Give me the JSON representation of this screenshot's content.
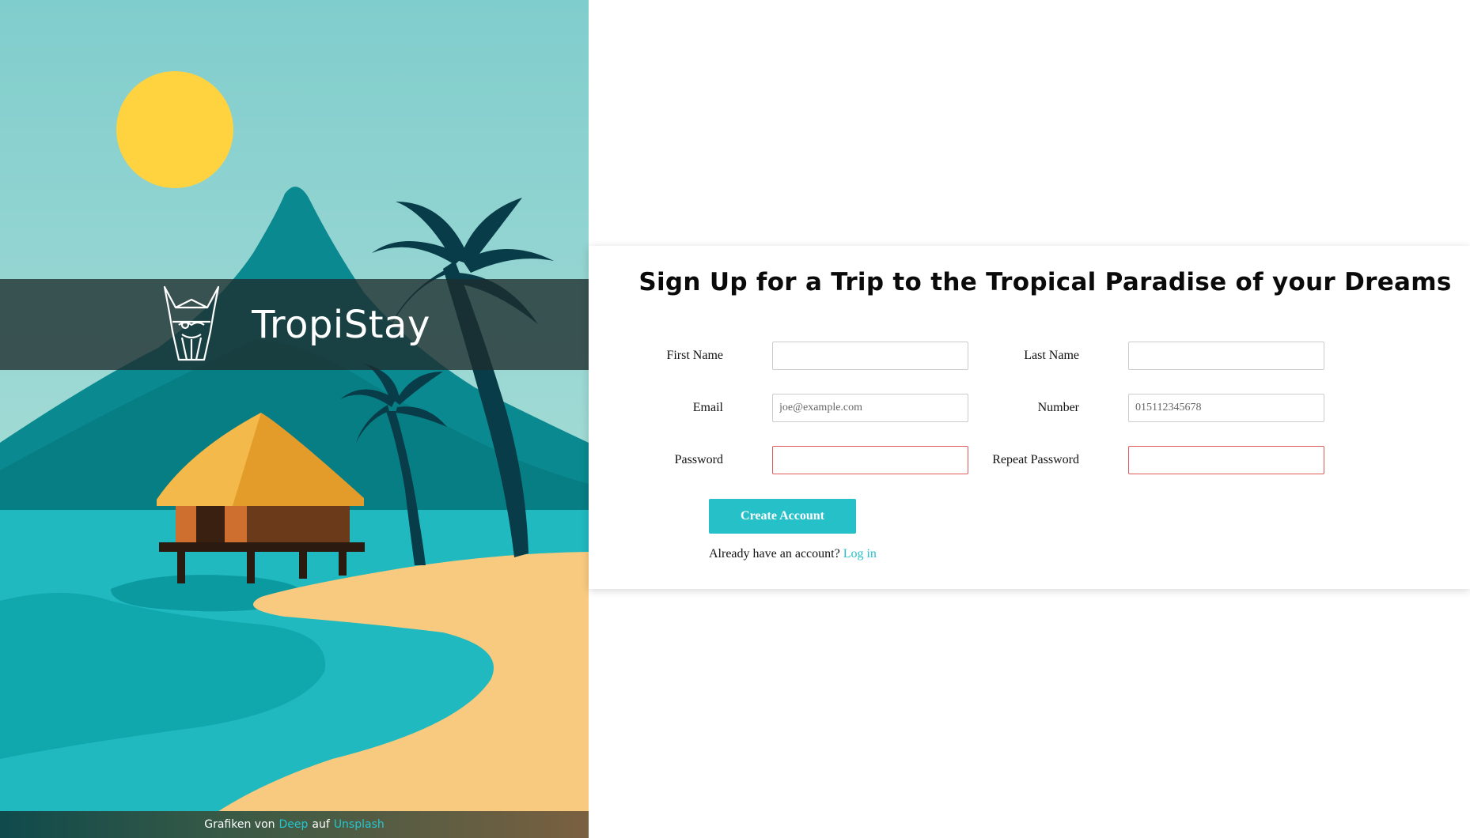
{
  "brand": {
    "name": "TropiStay",
    "logo_icon": "viking-head-icon"
  },
  "credit": {
    "prefix": "Grafiken von",
    "author": "Deep",
    "middle": "auf",
    "source": "Unsplash"
  },
  "form": {
    "title": "Sign Up for a Trip to the Tropical Paradise of your Dreams",
    "first_name": {
      "label": "First Name",
      "value": "",
      "placeholder": ""
    },
    "last_name": {
      "label": "Last Name",
      "value": "",
      "placeholder": ""
    },
    "email": {
      "label": "Email",
      "value": "",
      "placeholder": "joe@example.com"
    },
    "number": {
      "label": "Number",
      "value": "",
      "placeholder": "015112345678"
    },
    "password": {
      "label": "Password",
      "value": "",
      "placeholder": ""
    },
    "repeat_password": {
      "label": "Repeat Password",
      "value": "",
      "placeholder": ""
    },
    "submit_label": "Create Account",
    "login_prompt": "Already have an account?",
    "login_link": "Log in"
  },
  "colors": {
    "accent": "#25c0c8",
    "invalid_border": "#e05a5a",
    "sky": "#8ed3d0",
    "sun": "#ffd240",
    "sand": "#f8ca80"
  }
}
